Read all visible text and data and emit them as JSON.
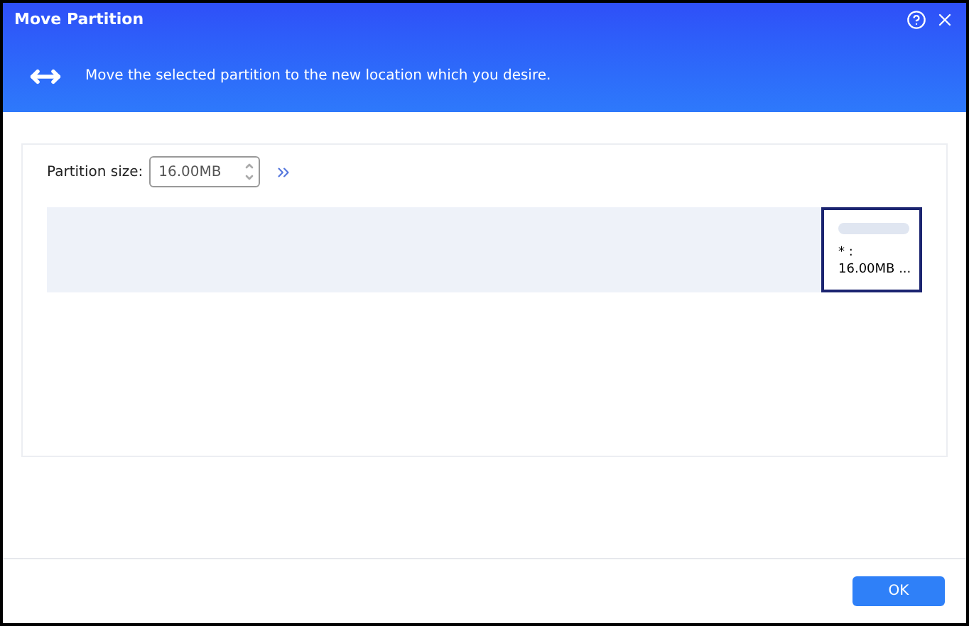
{
  "window": {
    "title": "Move Partition"
  },
  "description": "Move the selected partition to the new location which you desire.",
  "partition_size": {
    "label": "Partition size:",
    "value": "16.00MB"
  },
  "partition": {
    "label": "* :",
    "size": "16.00MB ...",
    "selected": true
  },
  "buttons": [
    "OK"
  ]
}
